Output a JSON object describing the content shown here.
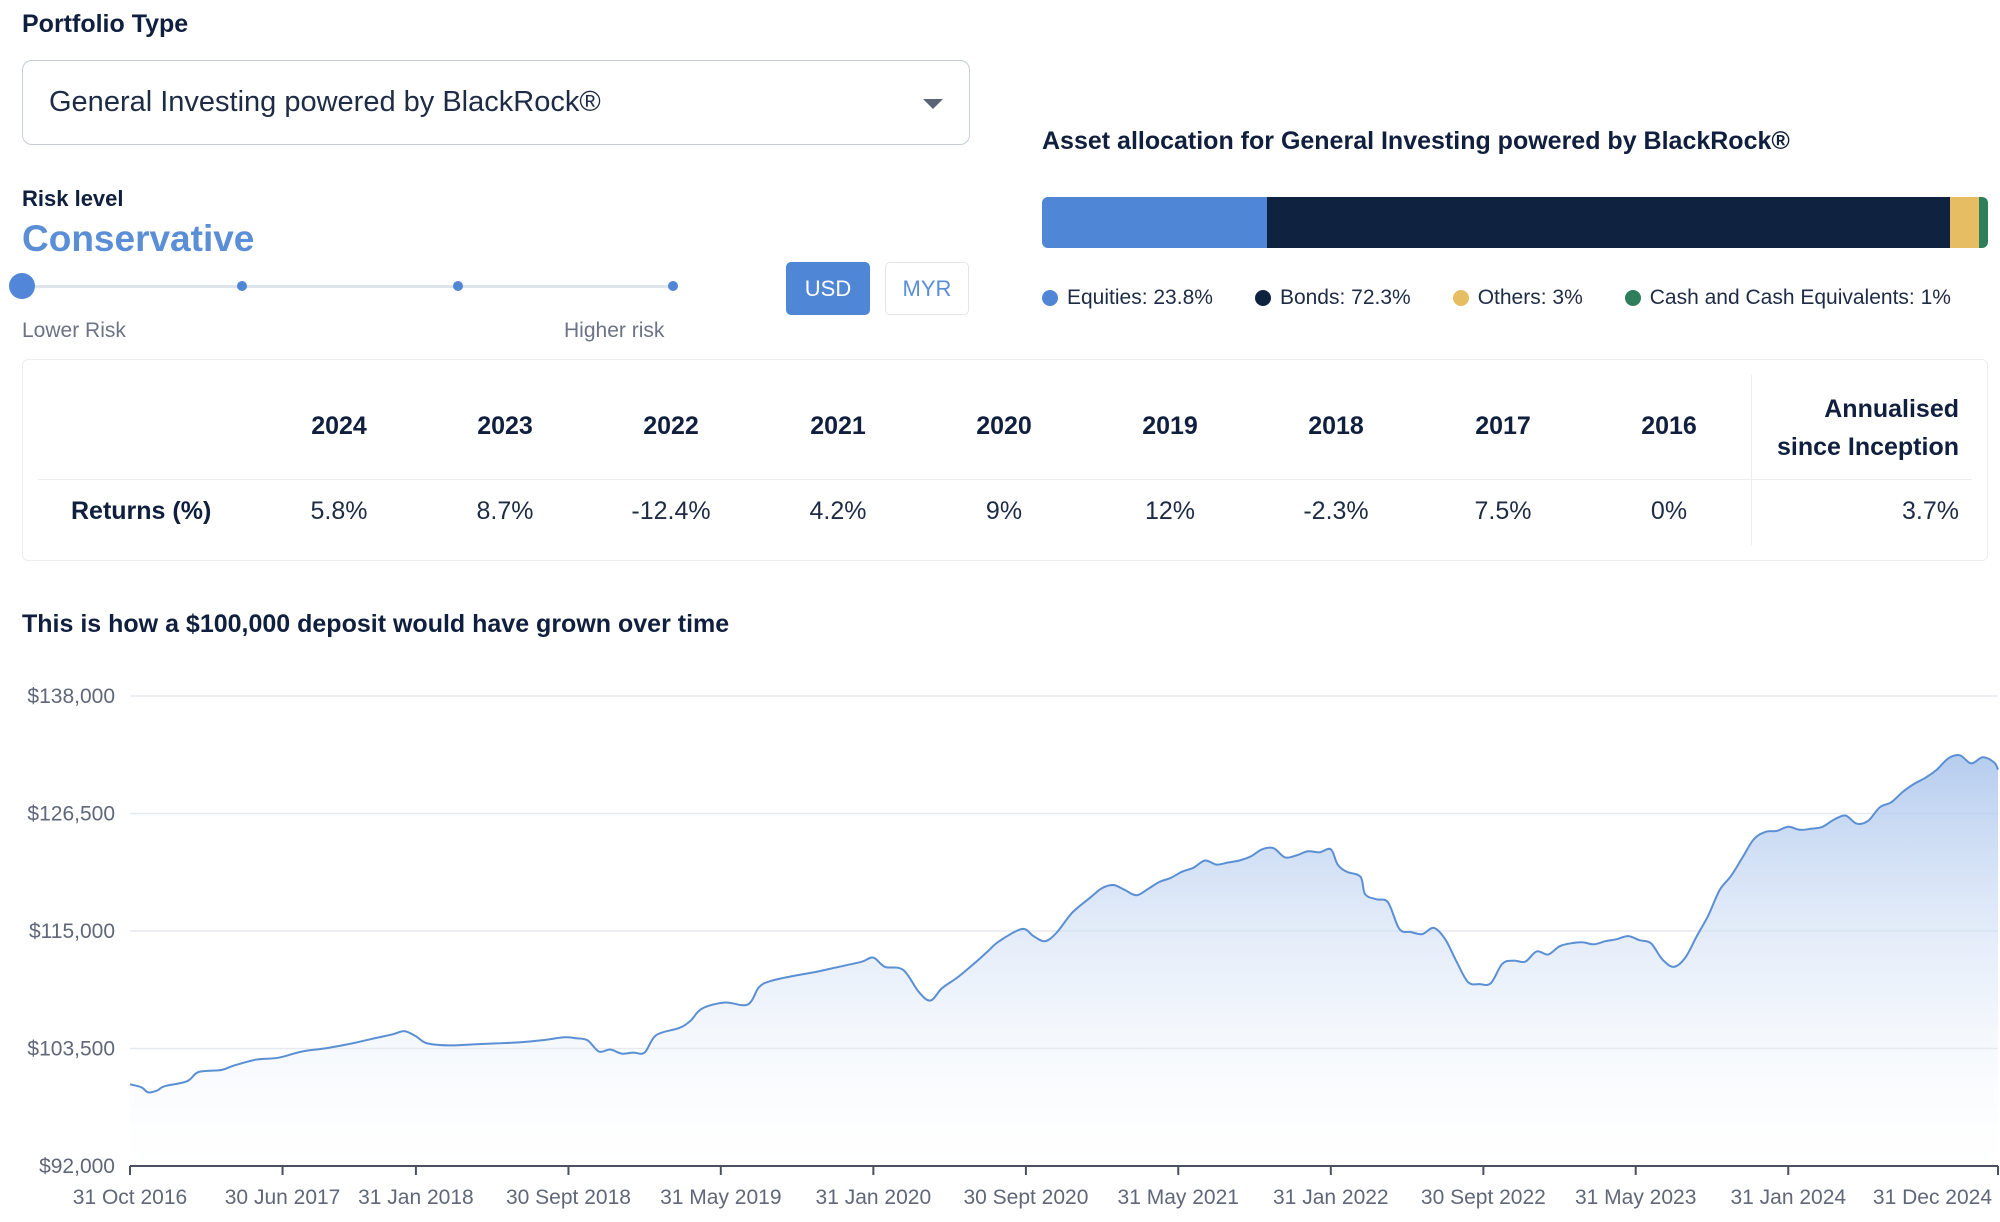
{
  "portfolio": {
    "label": "Portfolio Type",
    "selected": "General Investing powered by BlackRock®"
  },
  "risk": {
    "label": "Risk level",
    "value": "Conservative",
    "level": 1,
    "levels": 4,
    "lower_caption": "Lower Risk",
    "higher_caption": "Higher risk"
  },
  "currency": {
    "options": [
      "USD",
      "MYR"
    ],
    "selected": "USD"
  },
  "allocation": {
    "title": "Asset allocation for General Investing powered by BlackRock®",
    "items": [
      {
        "label": "Equities: 23.8%",
        "value": 23.8,
        "color": "#4f86d6"
      },
      {
        "label": "Bonds: 72.3%",
        "value": 72.3,
        "color": "#0f2340"
      },
      {
        "label": "Others: 3%",
        "value": 3,
        "color": "#e6bd63"
      },
      {
        "label": "Cash and Cash Equivalents: 1%",
        "value": 1,
        "color": "#2e7d5b"
      }
    ]
  },
  "returns": {
    "row_label": "Returns (%)",
    "years": [
      "2024",
      "2023",
      "2022",
      "2021",
      "2020",
      "2019",
      "2018",
      "2017",
      "2016"
    ],
    "values": [
      "5.8%",
      "8.7%",
      "-12.4%",
      "4.2%",
      "9%",
      "12%",
      "-2.3%",
      "7.5%",
      "0%"
    ],
    "annualised_label_1": "Annualised",
    "annualised_label_2": "since Inception",
    "annualised_value": "3.7%"
  },
  "chart_title": "This is how a $100,000 deposit would have grown over time",
  "chart_data": {
    "type": "area",
    "y_ticks": [
      "$138,000",
      "$126,500",
      "$115,000",
      "$103,500",
      "$92,000"
    ],
    "y_tick_values": [
      138000,
      126500,
      115000,
      103500,
      92000
    ],
    "ylim": [
      92000,
      138000
    ],
    "x_ticks": [
      "31 Oct 2016",
      "30 Jun 2017",
      "31 Jan 2018",
      "30 Sept 2018",
      "31 May 2019",
      "31 Jan 2020",
      "30 Sept 2020",
      "31 May 2021",
      "31 Jan 2022",
      "30 Sept 2022",
      "31 May 2023",
      "31 Jan 2024",
      "31 Dec 2024"
    ],
    "x_tick_positions": [
      0,
      0.667,
      1.25,
      1.917,
      2.583,
      3.25,
      3.917,
      4.583,
      5.25,
      5.917,
      6.583,
      7.25,
      8.167
    ],
    "x_max": 8.167,
    "grid": true,
    "line_color": "#5b8fd4",
    "fill_color": "#a9c4ec",
    "series": [
      {
        "points": [
          [
            0,
            100000
          ],
          [
            0.05,
            99700
          ],
          [
            0.08,
            99200
          ],
          [
            0.12,
            99400
          ],
          [
            0.15,
            99800
          ],
          [
            0.25,
            100300
          ],
          [
            0.3,
            101200
          ],
          [
            0.4,
            101400
          ],
          [
            0.45,
            101800
          ],
          [
            0.55,
            102400
          ],
          [
            0.65,
            102600
          ],
          [
            0.75,
            103200
          ],
          [
            0.85,
            103500
          ],
          [
            0.95,
            103900
          ],
          [
            1.05,
            104400
          ],
          [
            1.15,
            104900
          ],
          [
            1.2,
            105200
          ],
          [
            1.25,
            104700
          ],
          [
            1.3,
            104000
          ],
          [
            1.4,
            103800
          ],
          [
            1.5,
            103900
          ],
          [
            1.6,
            104000
          ],
          [
            1.7,
            104100
          ],
          [
            1.8,
            104300
          ],
          [
            1.9,
            104600
          ],
          [
            1.95,
            104500
          ],
          [
            2.0,
            104300
          ],
          [
            2.05,
            103200
          ],
          [
            2.1,
            103400
          ],
          [
            2.15,
            103000
          ],
          [
            2.2,
            103100
          ],
          [
            2.25,
            103100
          ],
          [
            2.3,
            104800
          ],
          [
            2.4,
            105500
          ],
          [
            2.45,
            106200
          ],
          [
            2.5,
            107400
          ],
          [
            2.6,
            108000
          ],
          [
            2.7,
            107800
          ],
          [
            2.75,
            109500
          ],
          [
            2.8,
            110100
          ],
          [
            2.9,
            110600
          ],
          [
            3.0,
            111000
          ],
          [
            3.1,
            111500
          ],
          [
            3.2,
            112000
          ],
          [
            3.25,
            112400
          ],
          [
            3.3,
            111500
          ],
          [
            3.38,
            111200
          ],
          [
            3.45,
            109000
          ],
          [
            3.5,
            108200
          ],
          [
            3.55,
            109400
          ],
          [
            3.62,
            110500
          ],
          [
            3.7,
            112000
          ],
          [
            3.75,
            113000
          ],
          [
            3.8,
            114000
          ],
          [
            3.9,
            115200
          ],
          [
            3.95,
            114500
          ],
          [
            4.0,
            114000
          ],
          [
            4.05,
            114800
          ],
          [
            4.12,
            116800
          ],
          [
            4.2,
            118300
          ],
          [
            4.25,
            119200
          ],
          [
            4.3,
            119500
          ],
          [
            4.35,
            119000
          ],
          [
            4.4,
            118500
          ],
          [
            4.45,
            119100
          ],
          [
            4.5,
            119800
          ],
          [
            4.55,
            120200
          ],
          [
            4.6,
            120800
          ],
          [
            4.65,
            121200
          ],
          [
            4.7,
            121900
          ],
          [
            4.75,
            121500
          ],
          [
            4.8,
            121700
          ],
          [
            4.85,
            121900
          ],
          [
            4.9,
            122300
          ],
          [
            4.95,
            123000
          ],
          [
            5.0,
            123100
          ],
          [
            5.05,
            122200
          ],
          [
            5.1,
            122400
          ],
          [
            5.15,
            122800
          ],
          [
            5.2,
            122700
          ],
          [
            5.25,
            123000
          ],
          [
            5.28,
            121500
          ],
          [
            5.32,
            120800
          ],
          [
            5.38,
            120300
          ],
          [
            5.4,
            118600
          ],
          [
            5.45,
            118100
          ],
          [
            5.5,
            117800
          ],
          [
            5.55,
            115200
          ],
          [
            5.6,
            114900
          ],
          [
            5.65,
            114700
          ],
          [
            5.7,
            115300
          ],
          [
            5.75,
            114200
          ],
          [
            5.8,
            112000
          ],
          [
            5.85,
            110000
          ],
          [
            5.9,
            109800
          ],
          [
            5.95,
            109900
          ],
          [
            6.0,
            111800
          ],
          [
            6.05,
            112100
          ],
          [
            6.1,
            112000
          ],
          [
            6.15,
            113000
          ],
          [
            6.2,
            112700
          ],
          [
            6.25,
            113500
          ],
          [
            6.3,
            113800
          ],
          [
            6.35,
            113900
          ],
          [
            6.4,
            113700
          ],
          [
            6.45,
            114000
          ],
          [
            6.5,
            114200
          ],
          [
            6.55,
            114500
          ],
          [
            6.6,
            114100
          ],
          [
            6.65,
            113800
          ],
          [
            6.7,
            112200
          ],
          [
            6.75,
            111500
          ],
          [
            6.8,
            112400
          ],
          [
            6.85,
            114500
          ],
          [
            6.9,
            116500
          ],
          [
            6.95,
            119000
          ],
          [
            7.0,
            120400
          ],
          [
            7.05,
            122200
          ],
          [
            7.1,
            124000
          ],
          [
            7.15,
            124700
          ],
          [
            7.2,
            124800
          ],
          [
            7.25,
            125200
          ],
          [
            7.3,
            124900
          ],
          [
            7.35,
            125000
          ],
          [
            7.4,
            125200
          ],
          [
            7.45,
            125900
          ],
          [
            7.5,
            126300
          ],
          [
            7.55,
            125500
          ],
          [
            7.6,
            125800
          ],
          [
            7.65,
            127100
          ],
          [
            7.7,
            127600
          ],
          [
            7.75,
            128600
          ],
          [
            7.8,
            129400
          ],
          [
            7.85,
            130000
          ],
          [
            7.9,
            130800
          ],
          [
            7.95,
            131900
          ],
          [
            8.0,
            132200
          ],
          [
            8.05,
            131400
          ],
          [
            8.1,
            132000
          ],
          [
            8.15,
            131500
          ],
          [
            8.167,
            130800
          ]
        ]
      }
    ]
  }
}
